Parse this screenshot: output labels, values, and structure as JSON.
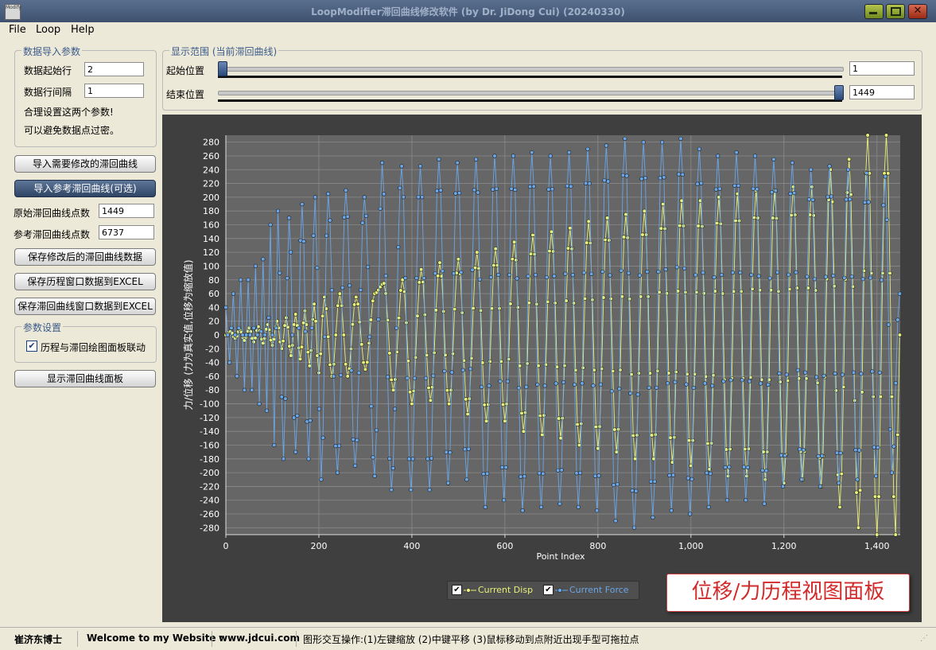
{
  "window": {
    "title": "LoopModifier滞回曲线修改软件 (by Dr. JiDong Cui) (20240330)",
    "app_icon_text": "Modify"
  },
  "menu": [
    "File",
    "Loop",
    "Help"
  ],
  "import_params": {
    "legend": "数据导入参数",
    "start_row_label": "数据起始行",
    "start_row_value": "2",
    "interval_label": "数据行间隔",
    "interval_value": "1",
    "note1": "合理设置这两个参数!",
    "note2": "可以避免数据点过密。"
  },
  "buttons": {
    "import_modify": "导入需要修改的滞回曲线",
    "import_reference": "导入参考滞回曲线(可选)",
    "save_modified": "保存修改后的滞回曲线数据",
    "save_history_excel": "保存历程窗口数据到EXCEL",
    "save_loop_excel": "保存滞回曲线窗口数据到EXCEL",
    "show_loop_panel": "显示滞回曲线面板"
  },
  "counts": {
    "orig_label": "原始滞回曲线点数",
    "orig_value": "1449",
    "ref_label": "参考滞回曲线点数",
    "ref_value": "6737"
  },
  "settings": {
    "legend": "参数设置",
    "link_label": "历程与滞回绘图面板联动",
    "link_checked": true
  },
  "range": {
    "legend": "显示范围 (当前滞回曲线)",
    "start_label": "起始位置",
    "start_value": "1",
    "end_label": "结束位置",
    "end_value": "1449",
    "min": 1,
    "max": 1449
  },
  "panel_caption": "位移/力历程视图面板",
  "statusbar": {
    "author": "崔济东博士",
    "welcome": "Welcome to my Website :",
    "site": "www.jdcui.com",
    "hint": "图形交互操作:(1)左键缩放 (2)中键平移 (3)鼠标移动到点附近出现手型可拖拉点"
  },
  "colors": {
    "disp": "#e8f07a",
    "force": "#6aa6e8",
    "plot_bg": "#666666",
    "outer_bg": "#3f3f3f"
  },
  "chart_data": {
    "type": "line",
    "xlabel": "Point Index",
    "ylabel": "力/位移 (力为真实值,位移为缩放值)",
    "xlim": [
      0,
      1450
    ],
    "ylim": [
      -290,
      290
    ],
    "xticks": [
      0,
      200,
      400,
      600,
      800,
      1000,
      1200,
      1400
    ],
    "xtick_labels": [
      "0",
      "200",
      "400",
      "600",
      "800",
      "1,000",
      "1,200",
      "1,400"
    ],
    "yticks": [
      -280,
      -260,
      -240,
      -220,
      -200,
      -180,
      -160,
      -140,
      -120,
      -100,
      -80,
      -60,
      -40,
      -20,
      0,
      20,
      40,
      60,
      80,
      100,
      120,
      140,
      160,
      180,
      200,
      220,
      240,
      260,
      280
    ],
    "grid": true,
    "legend_position": "bottom-center",
    "series": [
      {
        "name": "Current Disp",
        "color": "#e8f07a",
        "peaks": [
          [
            0,
            0
          ],
          [
            10,
            5
          ],
          [
            20,
            -5
          ],
          [
            30,
            8
          ],
          [
            40,
            -8
          ],
          [
            50,
            10
          ],
          [
            60,
            -10
          ],
          [
            70,
            12
          ],
          [
            80,
            -12
          ],
          [
            90,
            15
          ],
          [
            100,
            -15
          ],
          [
            110,
            20
          ],
          [
            120,
            -20
          ],
          [
            130,
            25
          ],
          [
            140,
            -30
          ],
          [
            150,
            30
          ],
          [
            160,
            -35
          ],
          [
            170,
            35
          ],
          [
            180,
            -45
          ],
          [
            190,
            45
          ],
          [
            200,
            -55
          ],
          [
            212,
            55
          ],
          [
            228,
            -60
          ],
          [
            245,
            60
          ],
          [
            262,
            -60
          ],
          [
            280,
            55
          ],
          [
            300,
            -50
          ],
          [
            320,
            60
          ],
          [
            340,
            75
          ],
          [
            360,
            -80
          ],
          [
            380,
            80
          ],
          [
            400,
            -100
          ],
          [
            420,
            95
          ],
          [
            440,
            -95
          ],
          [
            460,
            105
          ],
          [
            480,
            -100
          ],
          [
            500,
            110
          ],
          [
            520,
            -115
          ],
          [
            540,
            120
          ],
          [
            560,
            -125
          ],
          [
            580,
            125
          ],
          [
            600,
            -125
          ],
          [
            620,
            135
          ],
          [
            640,
            -140
          ],
          [
            660,
            145
          ],
          [
            680,
            -145
          ],
          [
            700,
            150
          ],
          [
            720,
            -150
          ],
          [
            740,
            155
          ],
          [
            760,
            -160
          ],
          [
            780,
            165
          ],
          [
            800,
            -165
          ],
          [
            820,
            170
          ],
          [
            840,
            -170
          ],
          [
            860,
            175
          ],
          [
            880,
            -180
          ],
          [
            900,
            180
          ],
          [
            920,
            -180
          ],
          [
            940,
            190
          ],
          [
            960,
            -185
          ],
          [
            980,
            195
          ],
          [
            1000,
            -190
          ],
          [
            1020,
            195
          ],
          [
            1040,
            -195
          ],
          [
            1060,
            200
          ],
          [
            1080,
            -205
          ],
          [
            1100,
            205
          ],
          [
            1120,
            -205
          ],
          [
            1140,
            210
          ],
          [
            1160,
            -210
          ],
          [
            1180,
            210
          ],
          [
            1200,
            -215
          ],
          [
            1220,
            215
          ],
          [
            1240,
            -210
          ],
          [
            1260,
            215
          ],
          [
            1280,
            -220
          ],
          [
            1300,
            240
          ],
          [
            1320,
            -250
          ],
          [
            1340,
            255
          ],
          [
            1360,
            -280
          ],
          [
            1380,
            290
          ],
          [
            1400,
            -290
          ],
          [
            1420,
            290
          ],
          [
            1440,
            -290
          ],
          [
            1449,
            0
          ]
        ]
      },
      {
        "name": "Current Force",
        "color": "#6aa6e8",
        "peaks": [
          [
            0,
            40
          ],
          [
            8,
            -40
          ],
          [
            16,
            60
          ],
          [
            24,
            -60
          ],
          [
            32,
            80
          ],
          [
            40,
            -80
          ],
          [
            48,
            80
          ],
          [
            56,
            -80
          ],
          [
            64,
            100
          ],
          [
            72,
            -100
          ],
          [
            80,
            110
          ],
          [
            88,
            -110
          ],
          [
            96,
            160
          ],
          [
            104,
            -160
          ],
          [
            112,
            180
          ],
          [
            124,
            -180
          ],
          [
            136,
            170
          ],
          [
            150,
            -170
          ],
          [
            164,
            190
          ],
          [
            178,
            -180
          ],
          [
            192,
            200
          ],
          [
            205,
            -210
          ],
          [
            220,
            205
          ],
          [
            240,
            -200
          ],
          [
            258,
            210
          ],
          [
            278,
            -190
          ],
          [
            298,
            200
          ],
          [
            320,
            -205
          ],
          [
            336,
            250
          ],
          [
            356,
            -225
          ],
          [
            378,
            245
          ],
          [
            398,
            -225
          ],
          [
            418,
            245
          ],
          [
            438,
            -225
          ],
          [
            458,
            255
          ],
          [
            478,
            -215
          ],
          [
            498,
            250
          ],
          [
            518,
            -210
          ],
          [
            538,
            255
          ],
          [
            558,
            -250
          ],
          [
            578,
            260
          ],
          [
            598,
            -240
          ],
          [
            618,
            260
          ],
          [
            638,
            -255
          ],
          [
            658,
            265
          ],
          [
            678,
            -250
          ],
          [
            698,
            260
          ],
          [
            718,
            -245
          ],
          [
            738,
            265
          ],
          [
            758,
            -250
          ],
          [
            778,
            270
          ],
          [
            798,
            -255
          ],
          [
            818,
            275
          ],
          [
            838,
            -270
          ],
          [
            858,
            285
          ],
          [
            878,
            -280
          ],
          [
            898,
            280
          ],
          [
            918,
            -265
          ],
          [
            938,
            280
          ],
          [
            958,
            -255
          ],
          [
            978,
            285
          ],
          [
            998,
            -260
          ],
          [
            1018,
            270
          ],
          [
            1038,
            -250
          ],
          [
            1058,
            260
          ],
          [
            1078,
            -240
          ],
          [
            1098,
            265
          ],
          [
            1118,
            -240
          ],
          [
            1138,
            260
          ],
          [
            1158,
            -245
          ],
          [
            1178,
            255
          ],
          [
            1198,
            -220
          ],
          [
            1218,
            250
          ],
          [
            1238,
            -210
          ],
          [
            1258,
            240
          ],
          [
            1278,
            -220
          ],
          [
            1298,
            245
          ],
          [
            1318,
            -215
          ],
          [
            1338,
            240
          ],
          [
            1358,
            -210
          ],
          [
            1378,
            235
          ],
          [
            1398,
            -205
          ],
          [
            1418,
            230
          ],
          [
            1432,
            -200
          ],
          [
            1449,
            60
          ]
        ]
      }
    ]
  }
}
